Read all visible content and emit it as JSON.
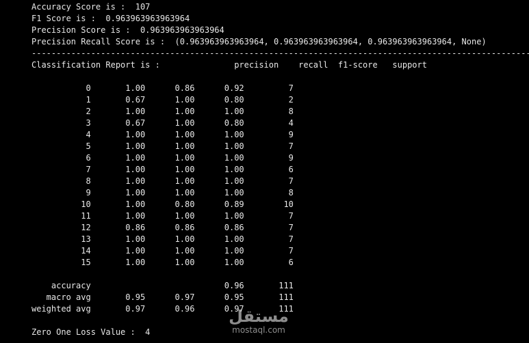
{
  "console": {
    "lines": [
      "Accuracy Score is :  107",
      "F1 Score is :  0.963963963963964",
      "Precision Score is :  0.963963963963964",
      "Precision Recall Score is :  (0.963963963963964, 0.963963963963964, 0.963963963963964, None)",
      "------------------------------------------------------------------------------------------------------",
      "Classification Report is :               precision    recall  f1-score   support",
      "",
      "           0       1.00      0.86      0.92         7",
      "           1       0.67      1.00      0.80         2",
      "           2       1.00      1.00      1.00         8",
      "           3       0.67      1.00      0.80         4",
      "           4       1.00      1.00      1.00         9",
      "           5       1.00      1.00      1.00         7",
      "           6       1.00      1.00      1.00         9",
      "           7       1.00      1.00      1.00         6",
      "           8       1.00      1.00      1.00         7",
      "           9       1.00      1.00      1.00         8",
      "          10       1.00      0.80      0.89        10",
      "          11       1.00      1.00      1.00         7",
      "          12       0.86      0.86      0.86         7",
      "          13       1.00      1.00      1.00         7",
      "          14       1.00      1.00      1.00         7",
      "          15       1.00      1.00      1.00         6",
      "",
      "    accuracy                           0.96       111",
      "   macro avg       0.95      0.97      0.95       111",
      "weighted avg       0.97      0.96      0.97       111",
      "",
      "Zero One Loss Value :  4"
    ]
  },
  "watermark": {
    "logo_text": "مستقل",
    "url_text": "mostaql.com"
  },
  "colors": {
    "background": "#000000",
    "text": "#e8e8e8"
  }
}
